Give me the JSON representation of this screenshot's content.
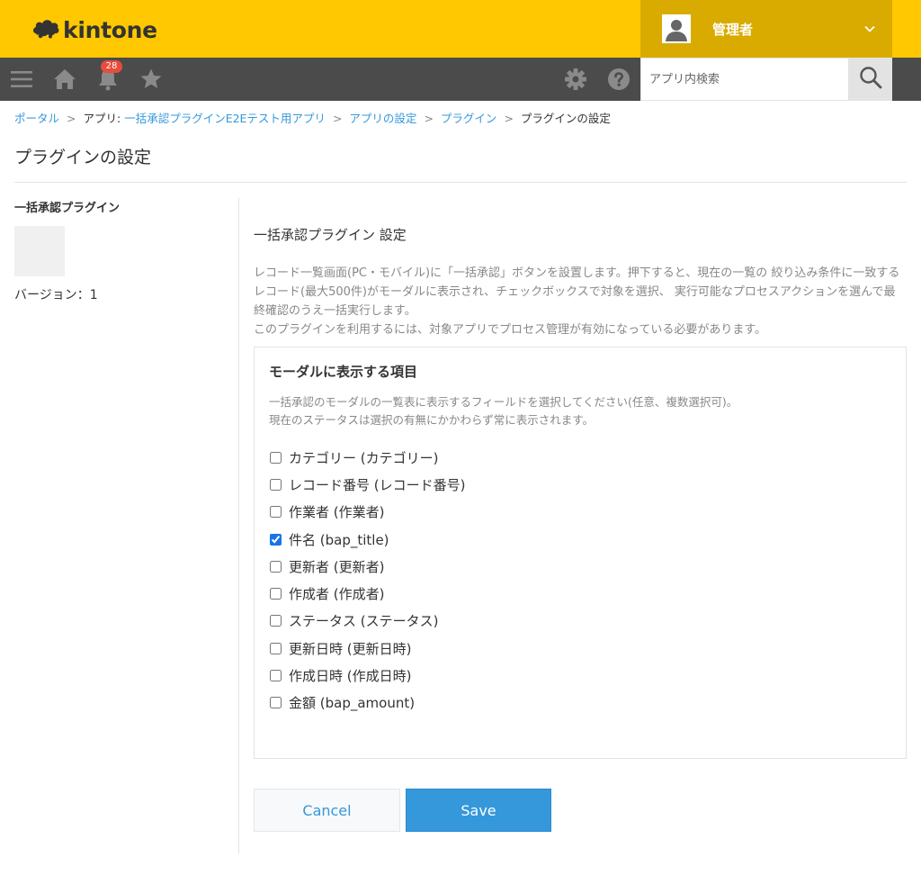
{
  "header": {
    "logo_text": "kintone",
    "user_name": "管理者"
  },
  "navbar": {
    "notification_count": "28",
    "search_placeholder": "アプリ内検索"
  },
  "breadcrumb": {
    "portal": "ポータル",
    "app_prefix": "アプリ: ",
    "app_name": "一括承認プラグインE2Eテスト用アプリ",
    "app_settings": "アプリの設定",
    "plugins": "プラグイン",
    "current": "プラグインの設定",
    "separator": ">"
  },
  "page": {
    "title": "プラグインの設定"
  },
  "sidebar": {
    "plugin_name": "一括承認プラグイン",
    "version": "バージョン：1"
  },
  "main": {
    "settings_title": "一括承認プラグイン 設定",
    "description_1": "レコード一覧画面(PC・モバイル)に「一括承認」ボタンを設置します。押下すると、現在の一覧の 絞り込み条件に一致するレコード(最大500件)がモーダルに表示され、チェックボックスで対象を選択、 実行可能なプロセスアクションを選んで最終確認のうえ一括実行します。",
    "description_2": "このプラグインを利用するには、対象アプリでプロセス管理が有効になっている必要があります。",
    "panel": {
      "title": "モーダルに表示する項目",
      "desc_1": "一括承認のモーダルの一覧表に表示するフィールドを選択してください(任意、複数選択可)。",
      "desc_2": "現在のステータスは選択の有無にかかわらず常に表示されます。",
      "fields": [
        {
          "label": "カテゴリー (カテゴリー)",
          "checked": false
        },
        {
          "label": "レコード番号 (レコード番号)",
          "checked": false
        },
        {
          "label": "作業者 (作業者)",
          "checked": false
        },
        {
          "label": "件名 (bap_title)",
          "checked": true
        },
        {
          "label": "更新者 (更新者)",
          "checked": false
        },
        {
          "label": "作成者 (作成者)",
          "checked": false
        },
        {
          "label": "ステータス (ステータス)",
          "checked": false
        },
        {
          "label": "更新日時 (更新日時)",
          "checked": false
        },
        {
          "label": "作成日時 (作成日時)",
          "checked": false
        },
        {
          "label": "金額 (bap_amount)",
          "checked": false
        }
      ]
    },
    "cancel_label": "Cancel",
    "save_label": "Save"
  },
  "colors": {
    "header_bg": "#ffc800",
    "user_menu_bg": "#d9ab00",
    "navbar_bg": "#4b4b4b",
    "link": "#3498db",
    "primary_button": "#3498db",
    "badge": "#e74c3c"
  },
  "icons": [
    "kintone-logo-icon",
    "user-avatar-icon",
    "chevron-down-icon",
    "menu-icon",
    "home-icon",
    "bell-icon",
    "star-icon",
    "gear-icon",
    "help-icon",
    "search-icon"
  ]
}
